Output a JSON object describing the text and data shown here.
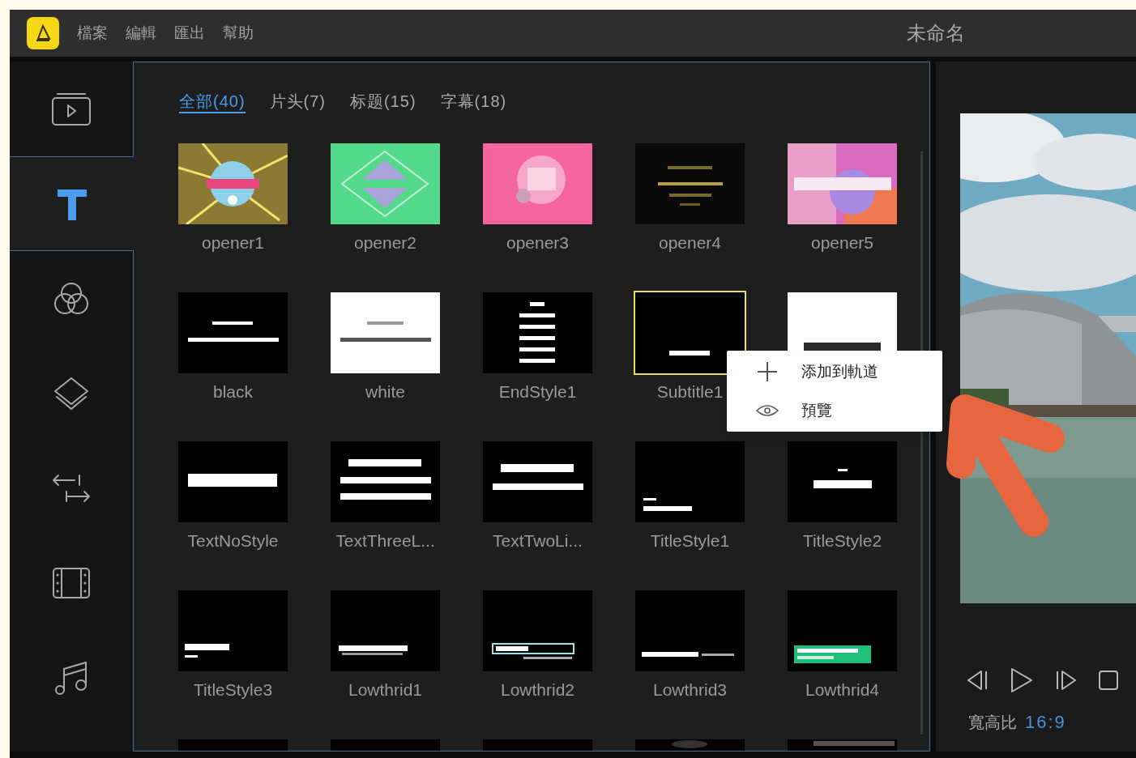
{
  "app": {
    "menu": [
      "檔案",
      "編輯",
      "匯出",
      "幫助"
    ],
    "title": "未命名"
  },
  "sidebar": {
    "items": [
      {
        "kind": "media",
        "selected": false
      },
      {
        "kind": "text",
        "selected": true
      },
      {
        "kind": "filter",
        "selected": false
      },
      {
        "kind": "overlay",
        "selected": false
      },
      {
        "kind": "transition",
        "selected": false
      },
      {
        "kind": "element",
        "selected": false
      },
      {
        "kind": "music",
        "selected": false
      }
    ]
  },
  "library": {
    "tabs": [
      {
        "label": "全部(40)",
        "selected": true
      },
      {
        "label": "片头(7)",
        "selected": false
      },
      {
        "label": "标题(15)",
        "selected": false
      },
      {
        "label": "字幕(18)",
        "selected": false
      }
    ],
    "templates": [
      {
        "label": "opener1",
        "selected": false
      },
      {
        "label": "opener2",
        "selected": false
      },
      {
        "label": "opener3",
        "selected": false
      },
      {
        "label": "opener4",
        "selected": false
      },
      {
        "label": "opener5",
        "selected": false
      },
      {
        "label": "black",
        "selected": false
      },
      {
        "label": "white",
        "selected": false
      },
      {
        "label": "EndStyle1",
        "selected": false
      },
      {
        "label": "Subtitle1",
        "selected": true
      },
      {
        "selected": false
      },
      {
        "label": "TextNoStyle",
        "selected": false
      },
      {
        "label": "TextThreeL...",
        "selected": false
      },
      {
        "label": "TextTwoLi...",
        "selected": false
      },
      {
        "label": "TitleStyle1",
        "selected": false
      },
      {
        "label": "TitleStyle2",
        "selected": false
      },
      {
        "label": "TitleStyle3",
        "selected": false
      },
      {
        "label": "Lowthrid1",
        "selected": false
      },
      {
        "label": "Lowthrid2",
        "selected": false
      },
      {
        "label": "Lowthrid3",
        "selected": false
      },
      {
        "label": "Lowthrid4",
        "selected": false
      },
      {
        "selected": false
      },
      {
        "selected": false
      },
      {
        "selected": false
      },
      {
        "selected": false
      },
      {
        "selected": false
      }
    ]
  },
  "context_menu": {
    "items": [
      {
        "kind": "add",
        "label": "添加到軌道"
      },
      {
        "kind": "preview",
        "label": "預覽"
      }
    ]
  },
  "preview": {
    "controls": [
      {
        "kind": "prev"
      },
      {
        "kind": "play"
      },
      {
        "kind": "next"
      },
      {
        "kind": "stop"
      }
    ],
    "aspect_label": "寬高比",
    "aspect_value": "16:9"
  }
}
